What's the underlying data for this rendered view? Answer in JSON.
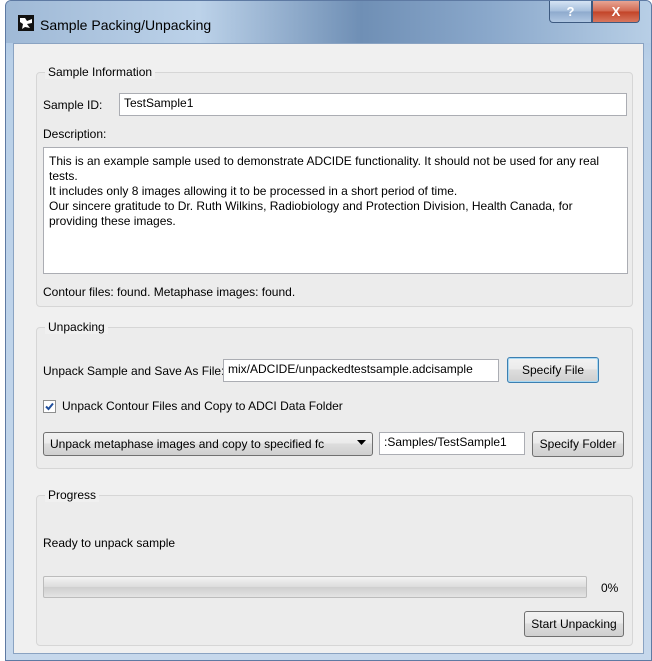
{
  "window": {
    "title": "Sample Packing/Unpacking",
    "help_label": "?",
    "close_label": "X"
  },
  "sample_info": {
    "group_title": "Sample Information",
    "sample_id_label": "Sample ID:",
    "sample_id_value": "TestSample1",
    "description_label": "Description:",
    "description_text": "This is an example sample used to demonstrate ADCIDE functionality. It should not be used for any real tests.\nIt includes only 8 images allowing it to be processed in a short period of time.\nOur sincere gratitude to Dr. Ruth Wilkins, Radiobiology and Protection Division, Health Canada, for providing these images.",
    "status_text": "Contour files: found. Metaphase images: found."
  },
  "unpacking": {
    "group_title": "Unpacking",
    "save_as_label": "Unpack Sample and Save As File:",
    "save_as_value": "mix/ADCIDE/unpackedtestsample.adcisample",
    "specify_file_label": "Specify File",
    "contour_checkbox_label": "Unpack Contour Files and Copy to ADCI Data Folder",
    "contour_checked": true,
    "images_option_selected": "Unpack metaphase images and copy to specified fc",
    "folder_value": ":Samples/TestSample1",
    "specify_folder_label": "Specify Folder"
  },
  "progress": {
    "group_title": "Progress",
    "status_text": "Ready to unpack sample",
    "percent_label": "0%",
    "percent_value": 0,
    "start_label": "Start Unpacking"
  },
  "background": {
    "fragment": "t"
  }
}
